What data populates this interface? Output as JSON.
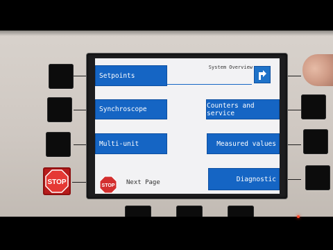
{
  "screen": {
    "title": "System Overview",
    "left_menu": [
      "Setpoints",
      "Synchroscope",
      "Multi-unit"
    ],
    "right_menu": [
      "Counters and service",
      "Measured values",
      "Diagnostic"
    ],
    "footer": {
      "stop_icon_text": "STOP",
      "next_page_label": "Next Page"
    }
  },
  "hardware": {
    "stop_key_label": "STOP"
  },
  "colors": {
    "menu_blue": "#1565c4",
    "screen_bg": "#f2f2f4",
    "stop_red": "#c62828"
  },
  "icons": {
    "back": "return-arrow-icon"
  }
}
